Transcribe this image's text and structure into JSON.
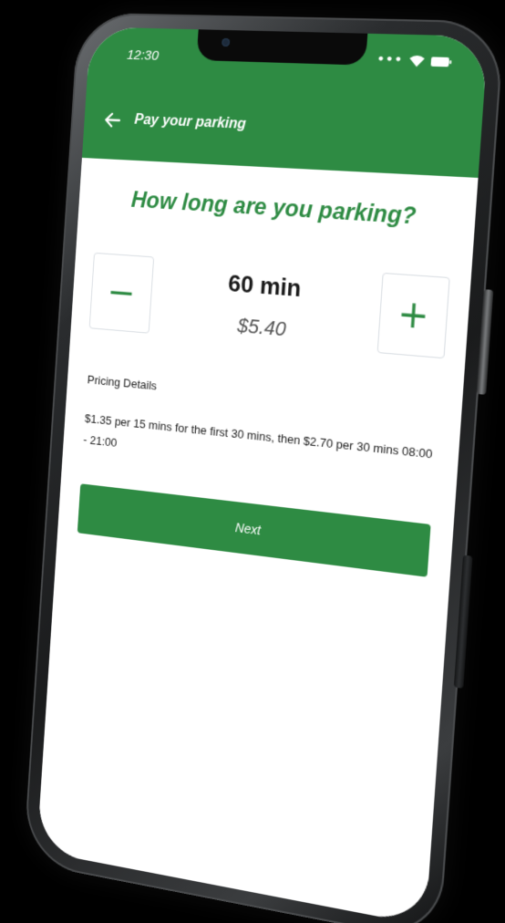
{
  "colors": {
    "brand": "#2e8b43",
    "background": "#000000",
    "surface": "#ffffff",
    "text_primary": "#1a1a1a",
    "text_secondary": "#555555"
  },
  "status_bar": {
    "time": "12:30",
    "icons": [
      "more-dots-icon",
      "wifi-icon",
      "battery-icon"
    ]
  },
  "app_bar": {
    "back_icon": "arrow-left-icon",
    "title": "Pay your parking"
  },
  "main": {
    "question": "How long are you parking?",
    "stepper": {
      "decrement_label": "−",
      "increment_label": "+",
      "duration": "60 min",
      "price": "$5.40"
    },
    "pricing": {
      "heading": "Pricing Details",
      "text": "$1.35 per 15 mins for the first 30 mins, then $2.70 per 30 mins 08:00 - 21:00"
    },
    "next_label": "Next"
  }
}
